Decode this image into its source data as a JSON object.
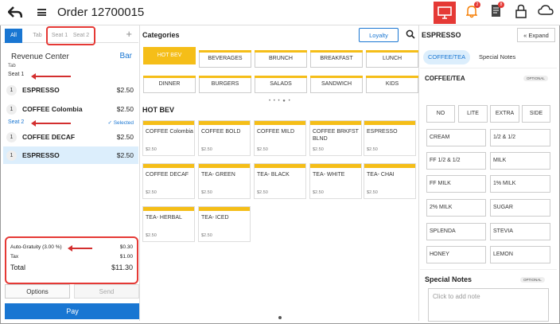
{
  "header": {
    "order_title": "Order 12700015",
    "notification_badge": "2",
    "print_badge": "8"
  },
  "left": {
    "tabs": [
      "All",
      "Tab",
      "Seat 1",
      "Seat 2"
    ],
    "revenue_center_label": "Revenue Center",
    "revenue_center_value": "Bar",
    "tab_label": "Tab",
    "seat1_label": "Seat 1",
    "seat2_label": "Seat 2",
    "selected_label": "Selected",
    "items": [
      {
        "qty": "1",
        "name": "ESPRESSO",
        "price": "$2.50"
      },
      {
        "qty": "1",
        "name": "COFFEE Colombia",
        "price": "$2.50"
      },
      {
        "qty": "1",
        "name": "COFFEE DECAF",
        "price": "$2.50"
      },
      {
        "qty": "1",
        "name": "ESPRESSO",
        "price": "$2.50"
      }
    ],
    "totals": {
      "gratuity_label": "Auto-Gratuity (3.00 %)",
      "gratuity_value": "$0.30",
      "tax_label": "Tax",
      "tax_value": "$1.00",
      "total_label": "Total",
      "total_value": "$11.30"
    },
    "options_label": "Options",
    "send_label": "Send",
    "pay_label": "Pay"
  },
  "middle": {
    "categories_title": "Categories",
    "loyalty_label": "Loyalty",
    "categories": [
      "HOT BEV",
      "BEVERAGES",
      "BRUNCH",
      "BREAKFAST",
      "LUNCH",
      "DINNER",
      "BURGERS",
      "SALADS",
      "SANDWICH",
      "KIDS"
    ],
    "section_title": "HOT BEV",
    "products": [
      {
        "name": "COFFEE Colombia",
        "price": "$2.50"
      },
      {
        "name": "COFFEE BOLD",
        "price": "$2.50"
      },
      {
        "name": "COFFEE MILD",
        "price": "$2.50"
      },
      {
        "name": "COFFEE BRKFST BLND",
        "price": "$2.50"
      },
      {
        "name": "ESPRESSO",
        "price": "$2.50"
      },
      {
        "name": "COFFEE DECAF",
        "price": "$2.50"
      },
      {
        "name": "TEA- GREEN",
        "price": "$2.50"
      },
      {
        "name": "TEA- BLACK",
        "price": "$2.50"
      },
      {
        "name": "TEA- WHITE",
        "price": "$2.50"
      },
      {
        "name": "TEA- CHAI",
        "price": "$2.50"
      },
      {
        "name": "TEA- HERBAL",
        "price": "$2.50"
      },
      {
        "name": "TEA- ICED",
        "price": "$2.50"
      }
    ]
  },
  "right": {
    "title": "ESPRESSO",
    "expand_label": "Expand",
    "tabs": [
      "COFFEE/TEA",
      "Special Notes"
    ],
    "section_title": "COFFEE/TEA",
    "optional_label": "OPTIONAL",
    "modifiers_small": [
      "NO",
      "LITE",
      "EXTRA",
      "SIDE"
    ],
    "modifiers": [
      "CREAM",
      "1/2 & 1/2",
      "FF 1/2 & 1/2",
      "MILK",
      "FF MILK",
      "1% MILK",
      "2% MILK",
      "SUGAR",
      "SPLENDA",
      "STEVIA",
      "HONEY",
      "LEMON"
    ],
    "notes_title": "Special Notes",
    "notes_optional": "OPTIONAL",
    "notes_placeholder": "Click to add note"
  }
}
